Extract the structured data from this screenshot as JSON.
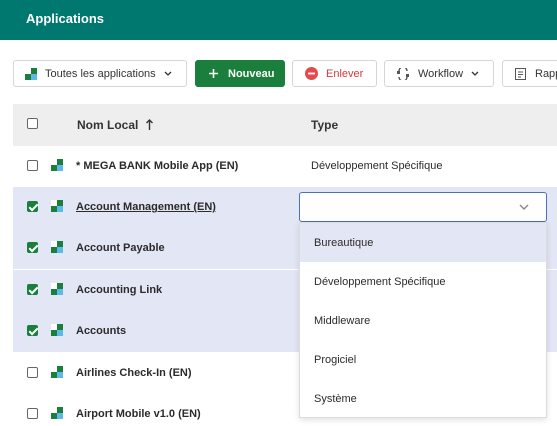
{
  "header": {
    "title": "Applications"
  },
  "toolbar": {
    "filter_label": "Toutes les applications",
    "new_label": "Nouveau",
    "remove_label": "Enlever",
    "workflow_label": "Workflow",
    "report_label": "Rapp"
  },
  "table": {
    "col_name": "Nom Local",
    "col_type": "Type",
    "rows": [
      {
        "name": "* MEGA BANK Mobile App (EN)",
        "type": "Développement Spécifique",
        "checked": false
      },
      {
        "name": "Account Management (EN)",
        "type": "",
        "checked": true
      },
      {
        "name": "Account Payable",
        "type": "",
        "checked": true
      },
      {
        "name": "Accounting Link",
        "type": "",
        "checked": true
      },
      {
        "name": "Accounts",
        "type": "",
        "checked": true
      },
      {
        "name": "Airlines Check-In (EN)",
        "type": "",
        "checked": false
      },
      {
        "name": "Airport Mobile v1.0 (EN)",
        "type": "",
        "checked": false
      }
    ]
  },
  "type_select": {
    "value": "",
    "options": [
      "Bureautique",
      "Développement Spécifique",
      "Middleware",
      "Progiciel",
      "Système"
    ]
  },
  "colors": {
    "header": "#00776f",
    "primary": "#1a7f3c",
    "danger": "#d03b3b",
    "selected_row": "#e3e6f5"
  }
}
